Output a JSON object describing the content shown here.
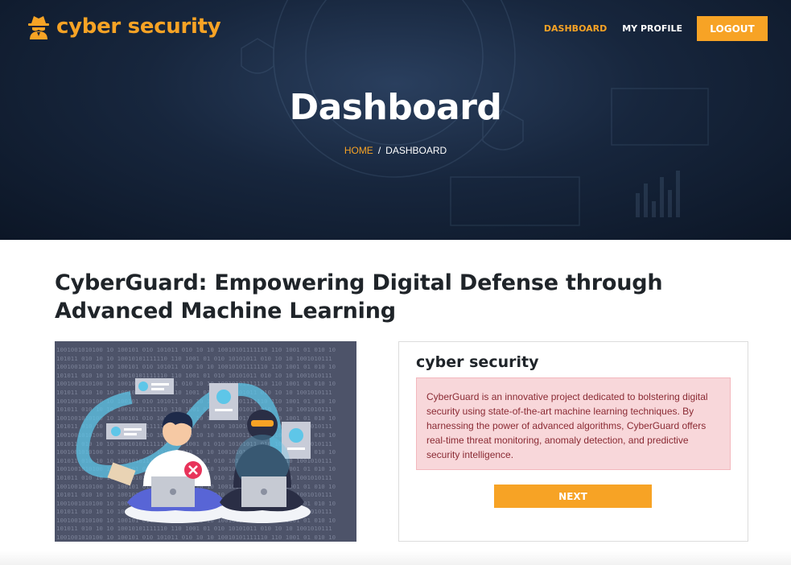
{
  "brand": {
    "name": "cyber security",
    "icon": "spy-icon"
  },
  "nav": {
    "items": [
      {
        "label": "DASHBOARD",
        "active": true
      },
      {
        "label": "MY PROFILE",
        "active": false
      }
    ],
    "logout_label": "LOGOUT"
  },
  "hero": {
    "title": "Dashboard",
    "breadcrumb": {
      "home": "HOME",
      "separator": "/",
      "current": "DASHBOARD"
    }
  },
  "main": {
    "heading_line1": "CyberGuard: Empowering Digital Defense through",
    "heading_line2": "Advanced Machine Learning"
  },
  "card": {
    "title": "cyber security",
    "description": "CyberGuard is an innovative project dedicated to bolstering digital security using state-of-the-art machine learning techniques. By harnessing the power of advanced algorithms, CyberGuard offers real-time threat monitoring, anomaly detection, and predictive security intelligence.",
    "next_label": "NEXT"
  },
  "colors": {
    "accent": "#f7a325",
    "hero_bg": "#17263d",
    "alert_bg": "#f8d7da",
    "alert_text": "#8a2a33"
  }
}
